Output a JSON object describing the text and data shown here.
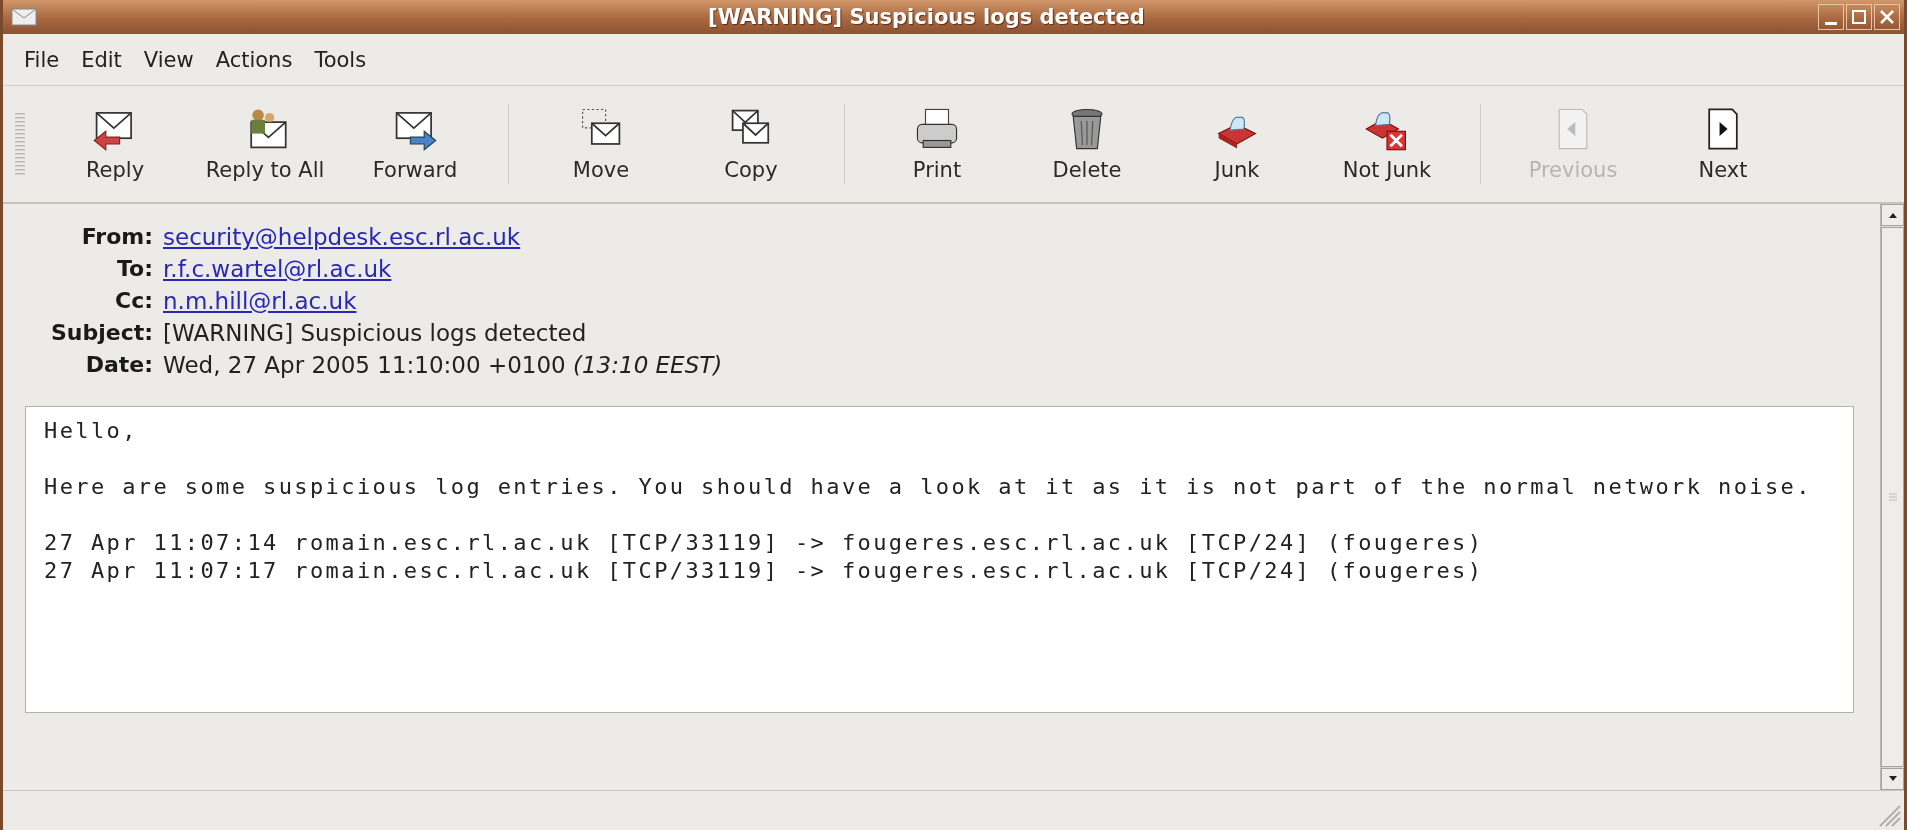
{
  "window": {
    "title": "[WARNING] Suspicious logs detected"
  },
  "menu": [
    {
      "label": "File"
    },
    {
      "label": "Edit"
    },
    {
      "label": "View"
    },
    {
      "label": "Actions"
    },
    {
      "label": "Tools"
    }
  ],
  "toolbar": {
    "groups": [
      [
        {
          "label": "Reply",
          "disabled": false
        },
        {
          "label": "Reply to All",
          "disabled": false
        },
        {
          "label": "Forward",
          "disabled": false
        }
      ],
      [
        {
          "label": "Move",
          "disabled": false
        },
        {
          "label": "Copy",
          "disabled": false
        }
      ],
      [
        {
          "label": "Print",
          "disabled": false
        },
        {
          "label": "Delete",
          "disabled": false
        },
        {
          "label": "Junk",
          "disabled": false
        },
        {
          "label": "Not Junk",
          "disabled": false
        }
      ],
      [
        {
          "label": "Previous",
          "disabled": true
        },
        {
          "label": "Next",
          "disabled": false
        }
      ]
    ]
  },
  "headers": [
    {
      "label": "From:",
      "value": "security@helpdesk.esc.rl.ac.uk",
      "kind": "link"
    },
    {
      "label": "To:",
      "value": "r.f.c.wartel@rl.ac.uk",
      "kind": "link"
    },
    {
      "label": "Cc:",
      "value": "n.m.hill@rl.ac.uk",
      "kind": "link"
    },
    {
      "label": "Subject:",
      "value": "[WARNING] Suspicious logs detected",
      "kind": "text"
    },
    {
      "label": "Date:",
      "value": "Wed, 27 Apr 2005 11:10:00 +0100  *(13:10 EEST)*",
      "kind": "text"
    }
  ],
  "body": {
    "paragraphs": [
      [
        "Hello,"
      ],
      [
        "Here are some suspicious log entries. You should have a look at it as it is not part of the normal network noise."
      ],
      [
        "27 Apr 11:07:14 romain.esc.rl.ac.uk [TCP/33119] -> fougeres.esc.rl.ac.uk [TCP/24] (fougeres)",
        "27 Apr 11:07:17 romain.esc.rl.ac.uk [TCP/33119] -> fougeres.esc.rl.ac.uk [TCP/24] (fougeres)"
      ]
    ]
  }
}
